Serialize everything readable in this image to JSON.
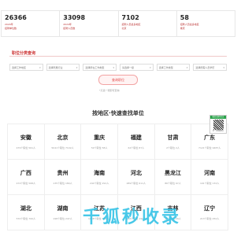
{
  "stats": [
    {
      "number": "26366",
      "line1": "2024年",
      "line2": "招聘单位数"
    },
    {
      "number": "33098",
      "line1": "2024年",
      "line2": "招聘人员数"
    },
    {
      "number": "7102",
      "line1": "招聘人员最多地区",
      "line2": "北京"
    },
    {
      "number": "58",
      "line1": "招聘人员最多地区",
      "line2": "重庆"
    }
  ],
  "filter": {
    "title": "职位分类查询",
    "selects": [
      "选择工作地区",
      "选择所属行业",
      "选择所在工作类型",
      "请选择一级",
      "选择工作类型",
      "选择所需人员学历"
    ],
    "query_button": "查询职位",
    "hint": "*只选一项即可查询"
  },
  "region": {
    "title": "按地区·快速查找单位",
    "provinces": [
      {
        "name": "安徽",
        "info": "479个职位 561人"
      },
      {
        "name": "北京",
        "info": "5041个职位 7102人"
      },
      {
        "name": "重庆",
        "info": "50个职位 58人"
      },
      {
        "name": "福建",
        "info": "62个职位 87人"
      },
      {
        "name": "甘肃",
        "info": "2个职位 2人"
      },
      {
        "name": "广东",
        "info": "7121个职位 9487人"
      },
      {
        "name": "广西",
        "info": "474个职位 568人"
      },
      {
        "name": "贵州",
        "info": "135个职位 180人"
      },
      {
        "name": "海南",
        "info": "244个职位 291人"
      },
      {
        "name": "河北",
        "info": "489个职位 611人"
      },
      {
        "name": "黑龙江",
        "info": "86个职位 97人"
      },
      {
        "name": "河南",
        "info": "101个职位 132人"
      },
      {
        "name": "湖北",
        "info": "570个职位 700人"
      },
      {
        "name": "湖南",
        "info": "198个职位 247人"
      },
      {
        "name": "江苏",
        "info": "1098个职位 1493人"
      },
      {
        "name": "江西",
        "info": "166个职位 190人"
      },
      {
        "name": "吉林",
        "info": "24个职位 29人"
      },
      {
        "name": "辽宁",
        "info": "213个职位 250人"
      }
    ]
  },
  "float_ad": {
    "top": "微信扫码关注",
    "caption": "扫一扫获取更多"
  },
  "watermark": "千狐秒收录"
}
